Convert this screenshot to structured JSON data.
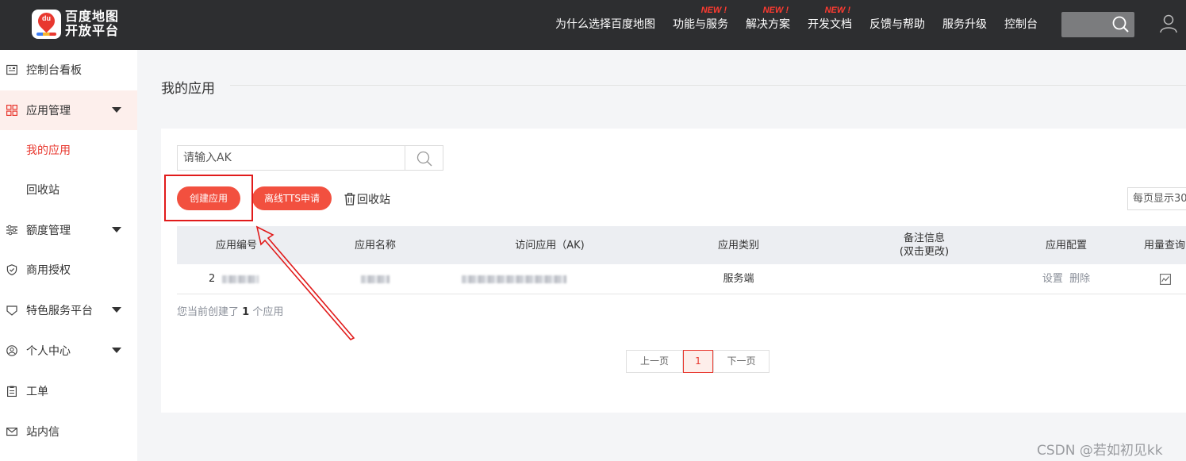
{
  "brand": {
    "logo_text_line1": "百度地图",
    "logo_text_line2": "开放平台",
    "logo_mark": "du"
  },
  "nav": {
    "items": [
      {
        "label": "为什么选择百度地图",
        "badge": ""
      },
      {
        "label": "功能与服务",
        "badge": "NEW !"
      },
      {
        "label": "解决方案",
        "badge": "NEW !"
      },
      {
        "label": "开发文档",
        "badge": "NEW !"
      },
      {
        "label": "反馈与帮助",
        "badge": ""
      },
      {
        "label": "服务升级",
        "badge": ""
      },
      {
        "label": "控制台",
        "badge": ""
      }
    ]
  },
  "sidebar": {
    "items": [
      {
        "label": "控制台看板",
        "icon": "dashboard-icon"
      },
      {
        "label": "应用管理",
        "icon": "grid-icon"
      },
      {
        "label": "我的应用"
      },
      {
        "label": "回收站"
      },
      {
        "label": "额度管理",
        "icon": "sliders-icon"
      },
      {
        "label": "商用授权",
        "icon": "shield-icon"
      },
      {
        "label": "特色服务平台",
        "icon": "heart-badge-icon"
      },
      {
        "label": "个人中心",
        "icon": "user-circle-icon"
      },
      {
        "label": "工单",
        "icon": "clipboard-icon"
      },
      {
        "label": "站内信",
        "icon": "mail-icon"
      }
    ]
  },
  "main": {
    "title": "我的应用",
    "search_placeholder": "请输入AK",
    "create_button": "创建应用",
    "tts_button": "离线TTS申请",
    "recycle_link": "回收站",
    "per_page_label": "每页显示30",
    "table": {
      "headers": [
        "应用编号",
        "应用名称",
        "访问应用（AK)",
        "应用类别",
        "备注信息\n(双击更改)",
        "应用配置",
        "用量查询"
      ],
      "rows": [
        {
          "id_prefix": "2",
          "category": "服务端",
          "config_set": "设置",
          "config_delete": "删除"
        }
      ]
    },
    "count_text_prefix": "您当前创建了",
    "count_value": "1",
    "count_text_suffix": "个应用",
    "pager": {
      "prev": "上一页",
      "current": "1",
      "next": "下一页"
    }
  },
  "watermark": "CSDN @若如初见kk",
  "colors": {
    "accent": "#f2503f",
    "topbar": "#2d2e30",
    "highlight": "#e11b1b"
  }
}
